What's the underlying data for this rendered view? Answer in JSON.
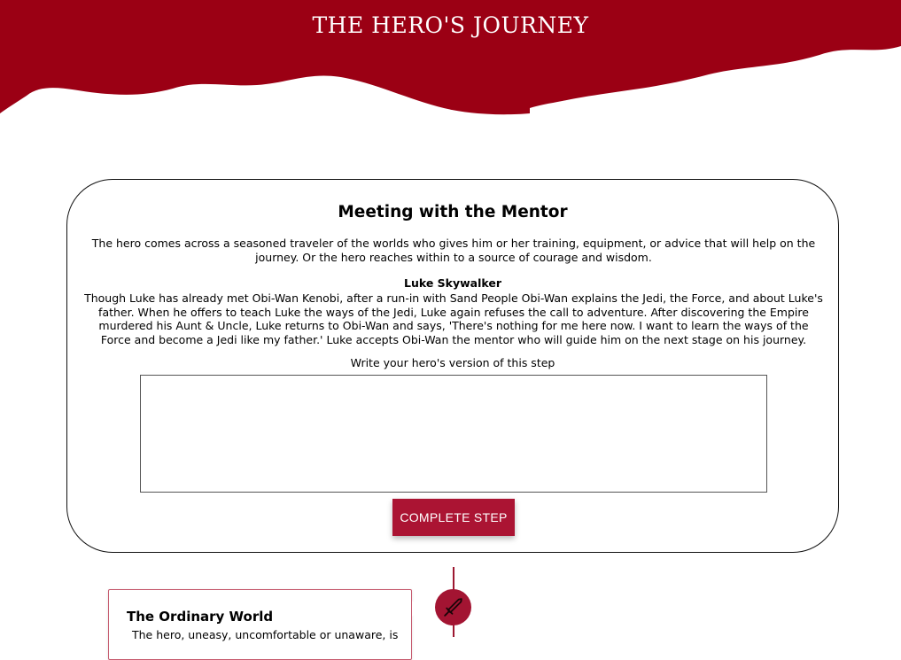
{
  "header": {
    "title": "THE HERO'S JOURNEY",
    "color": "#9b0014"
  },
  "step": {
    "title": "Meeting with the Mentor",
    "description": "The hero comes across a seasoned traveler of the worlds who gives him or her training, equipment, or advice that will help on the journey. Or the hero reaches within to a source of courage and wisdom.",
    "example_name": "Luke Skywalker",
    "example_text": "Though Luke has already met Obi-Wan Kenobi, after a run-in with Sand People Obi-Wan explains the Jedi, the Force, and about Luke's father. When he offers to teach Luke the ways of the Jedi, Luke again refuses the call to adventure. After discovering the Empire murdered his Aunt & Uncle, Luke returns to Obi-Wan and says, 'There's nothing for me here now. I want to learn the ways of the Force and become a Jedi like my father.' Luke accepts Obi-Wan the mentor who will guide him on the next stage on his journey.",
    "prompt_label": "Write your hero's version of this step",
    "answer_value": "",
    "button_label": "COMPLETE STEP",
    "accent": "#ab1433"
  },
  "timeline": {
    "marker_icon": "sword-icon",
    "items": [
      {
        "title": "The Ordinary World",
        "text": "The hero, uneasy, uncomfortable or unaware, is"
      }
    ]
  }
}
